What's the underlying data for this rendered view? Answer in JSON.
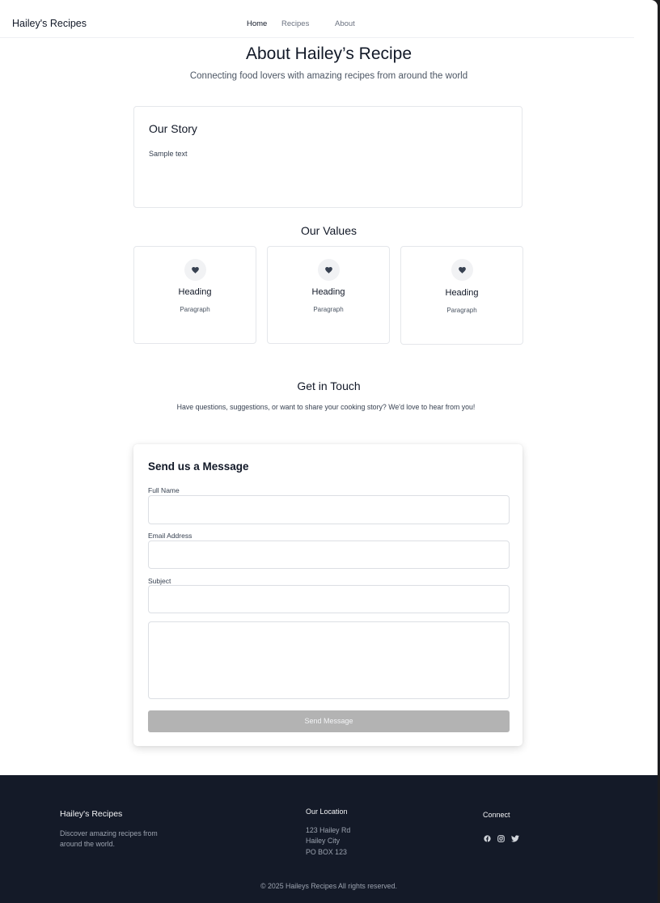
{
  "nav": {
    "brand": "Hailey's Recipes",
    "links": [
      "Home",
      "Recipes",
      "About"
    ]
  },
  "hero": {
    "title": "About Hailey’s Recipe",
    "subtitle": "Connecting food lovers with amazing recipes from around the world"
  },
  "story": {
    "title": "Our Story",
    "text": "Sample text"
  },
  "values": {
    "title": "Our Values",
    "items": [
      {
        "icon": "heart-icon",
        "heading": "Heading",
        "paragraph": "Paragraph"
      },
      {
        "icon": "heart-icon",
        "heading": "Heading",
        "paragraph": "Paragraph"
      },
      {
        "icon": "heart-icon",
        "heading": "Heading",
        "paragraph": "Paragraph"
      }
    ]
  },
  "contact": {
    "title": "Get in Touch",
    "text": "Have questions, suggestions, or want to share your cooking story? We'd love to hear from you!"
  },
  "form": {
    "title": "Send us a Message",
    "full_name_label": "Full Name",
    "full_name_value": "",
    "email_label": "Email Address",
    "email_value": "",
    "subject_label": "Subject",
    "subject_value": "",
    "message_value": "",
    "submit_label": "Send Message"
  },
  "footer": {
    "brand": "Hailey's Recipes",
    "description": "Discover amazing recipes from around the world.",
    "location_title": "Our Location",
    "location_lines": [
      "123 Hailey Rd",
      "Hailey City",
      "PO BOX 123"
    ],
    "connect_title": "Connect",
    "social_icons": [
      "facebook-icon",
      "instagram-icon",
      "twitter-icon"
    ],
    "copyright": "© 2025 Haileys Recipes All rights reserved."
  },
  "colors": {
    "footer_bg": "#141a28",
    "button_disabled": "#b3b3b3",
    "text_primary": "#111827",
    "text_muted": "#6b7280"
  }
}
